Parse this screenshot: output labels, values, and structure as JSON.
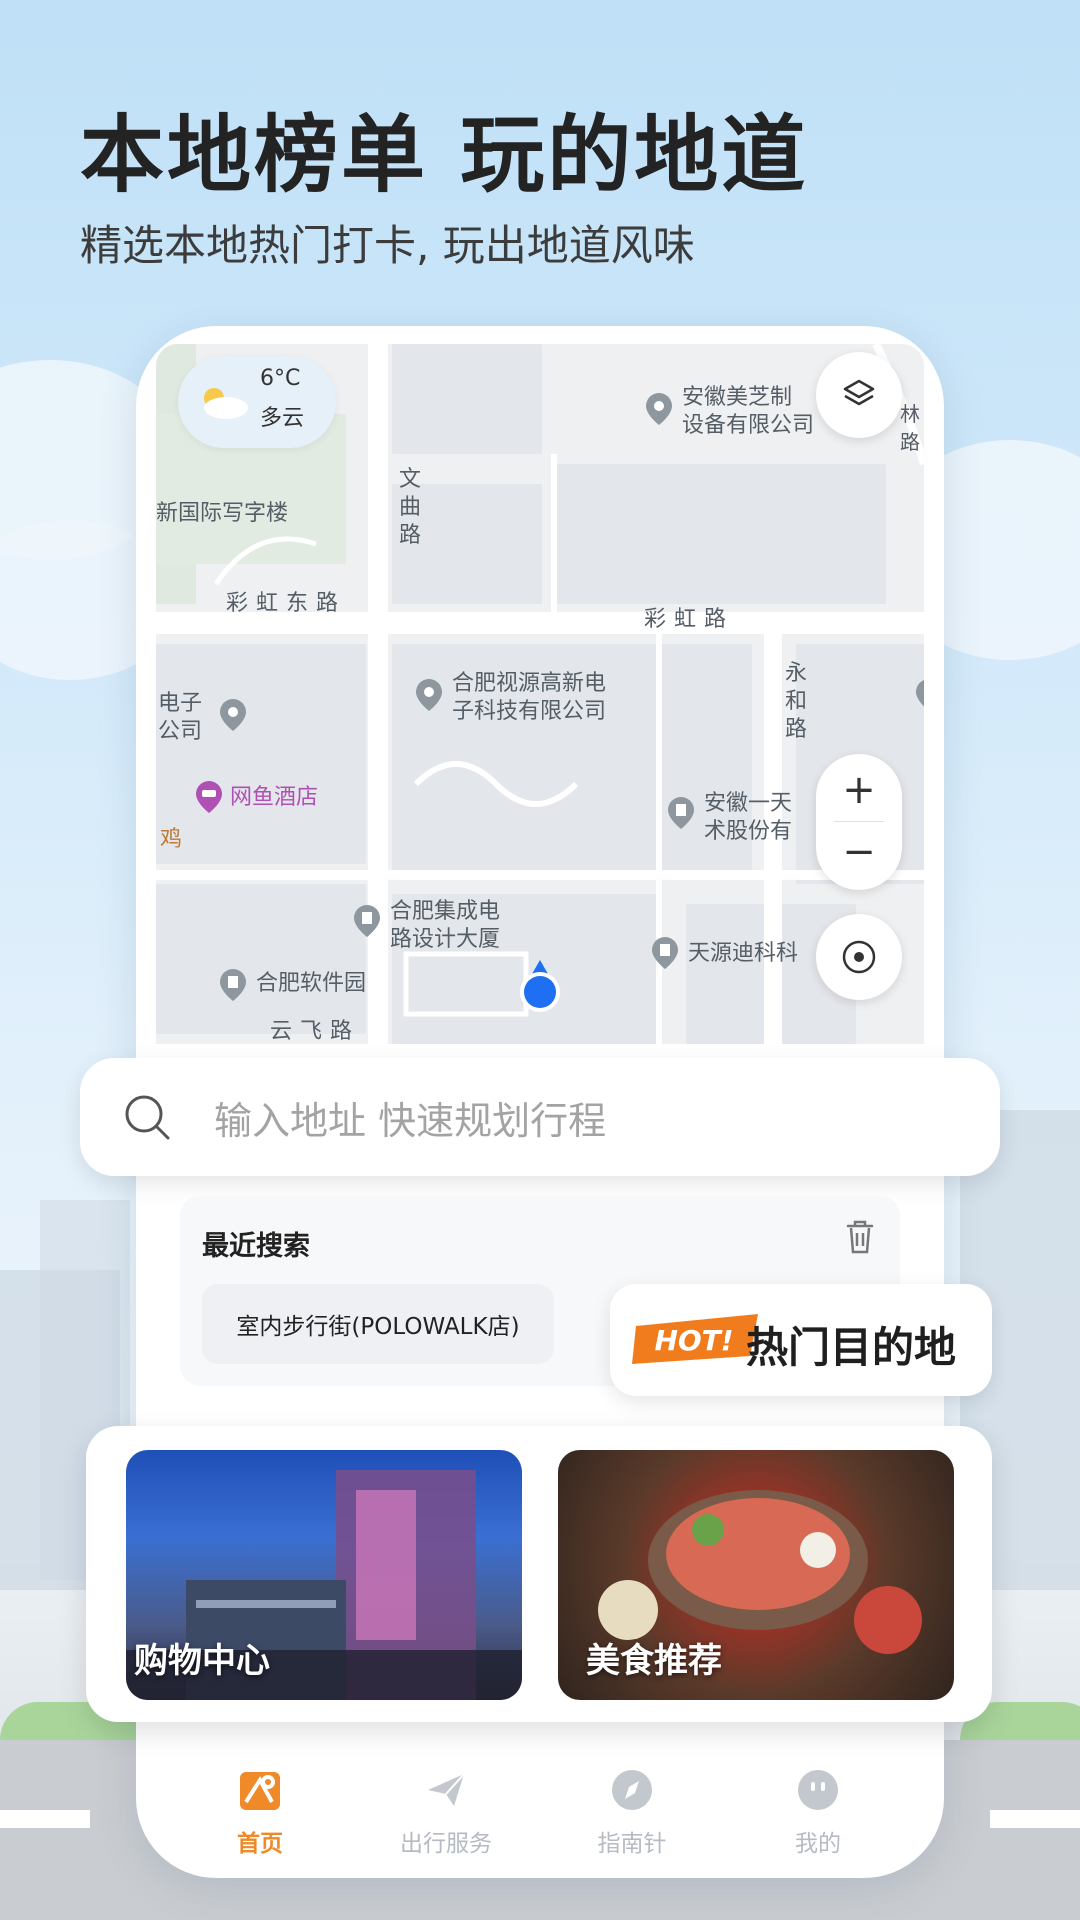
{
  "header": {
    "headline": "本地榜单 玩的地道",
    "subline": "精选本地热门打卡, 玩出地道风味"
  },
  "weather": {
    "temperature": "6°C",
    "condition": "多云",
    "icon": "partly-cloudy-icon"
  },
  "map": {
    "labels": {
      "anhui_meizhi": "安徽美芝制\n设备有限公司",
      "guoji_xiezilou": "新国际写字楼",
      "wenqu_road": "文曲路",
      "caihong_east": "彩虹东路",
      "caihong_road": "彩虹路",
      "yonghe_road": "永和路",
      "shiyuan": "合肥视源高新电\n子科技有限公司",
      "dianzi": "电子\n公司",
      "wangyu_hotel": "网鱼酒店",
      "ji": "鸡",
      "anhui_yitian": "安徽一天\n术股份有",
      "jicheng": "合肥集成电\n路设计大厦",
      "tianyuan": "天源迪科科",
      "ruanjianyuan": "合肥软件园",
      "yunfei_road": "云飞路",
      "lin_road": "林路"
    },
    "controls": {
      "layers": "layers-icon",
      "zoom_in": "+",
      "zoom_out": "−",
      "locate": "locate-icon"
    }
  },
  "search": {
    "placeholder": "输入地址 快速规划行程",
    "icon": "search-icon"
  },
  "recent": {
    "title": "最近搜索",
    "items": [
      "室内步行街(POLOWALK店)"
    ]
  },
  "hot": {
    "badge": "HOT!",
    "label": "热门目的地"
  },
  "cards": [
    {
      "label": "购物中心"
    },
    {
      "label": "美食推荐"
    }
  ],
  "tabs": [
    {
      "label": "首页",
      "icon": "home-map-icon",
      "active": true
    },
    {
      "label": "出行服务",
      "icon": "paper-plane-icon",
      "active": false
    },
    {
      "label": "指南针",
      "icon": "compass-icon",
      "active": false
    },
    {
      "label": "我的",
      "icon": "profile-icon",
      "active": false
    }
  ],
  "colors": {
    "accent": "#f08a28",
    "location_dot": "#1e6ff2",
    "hotel_poi": "#b04fb4"
  }
}
